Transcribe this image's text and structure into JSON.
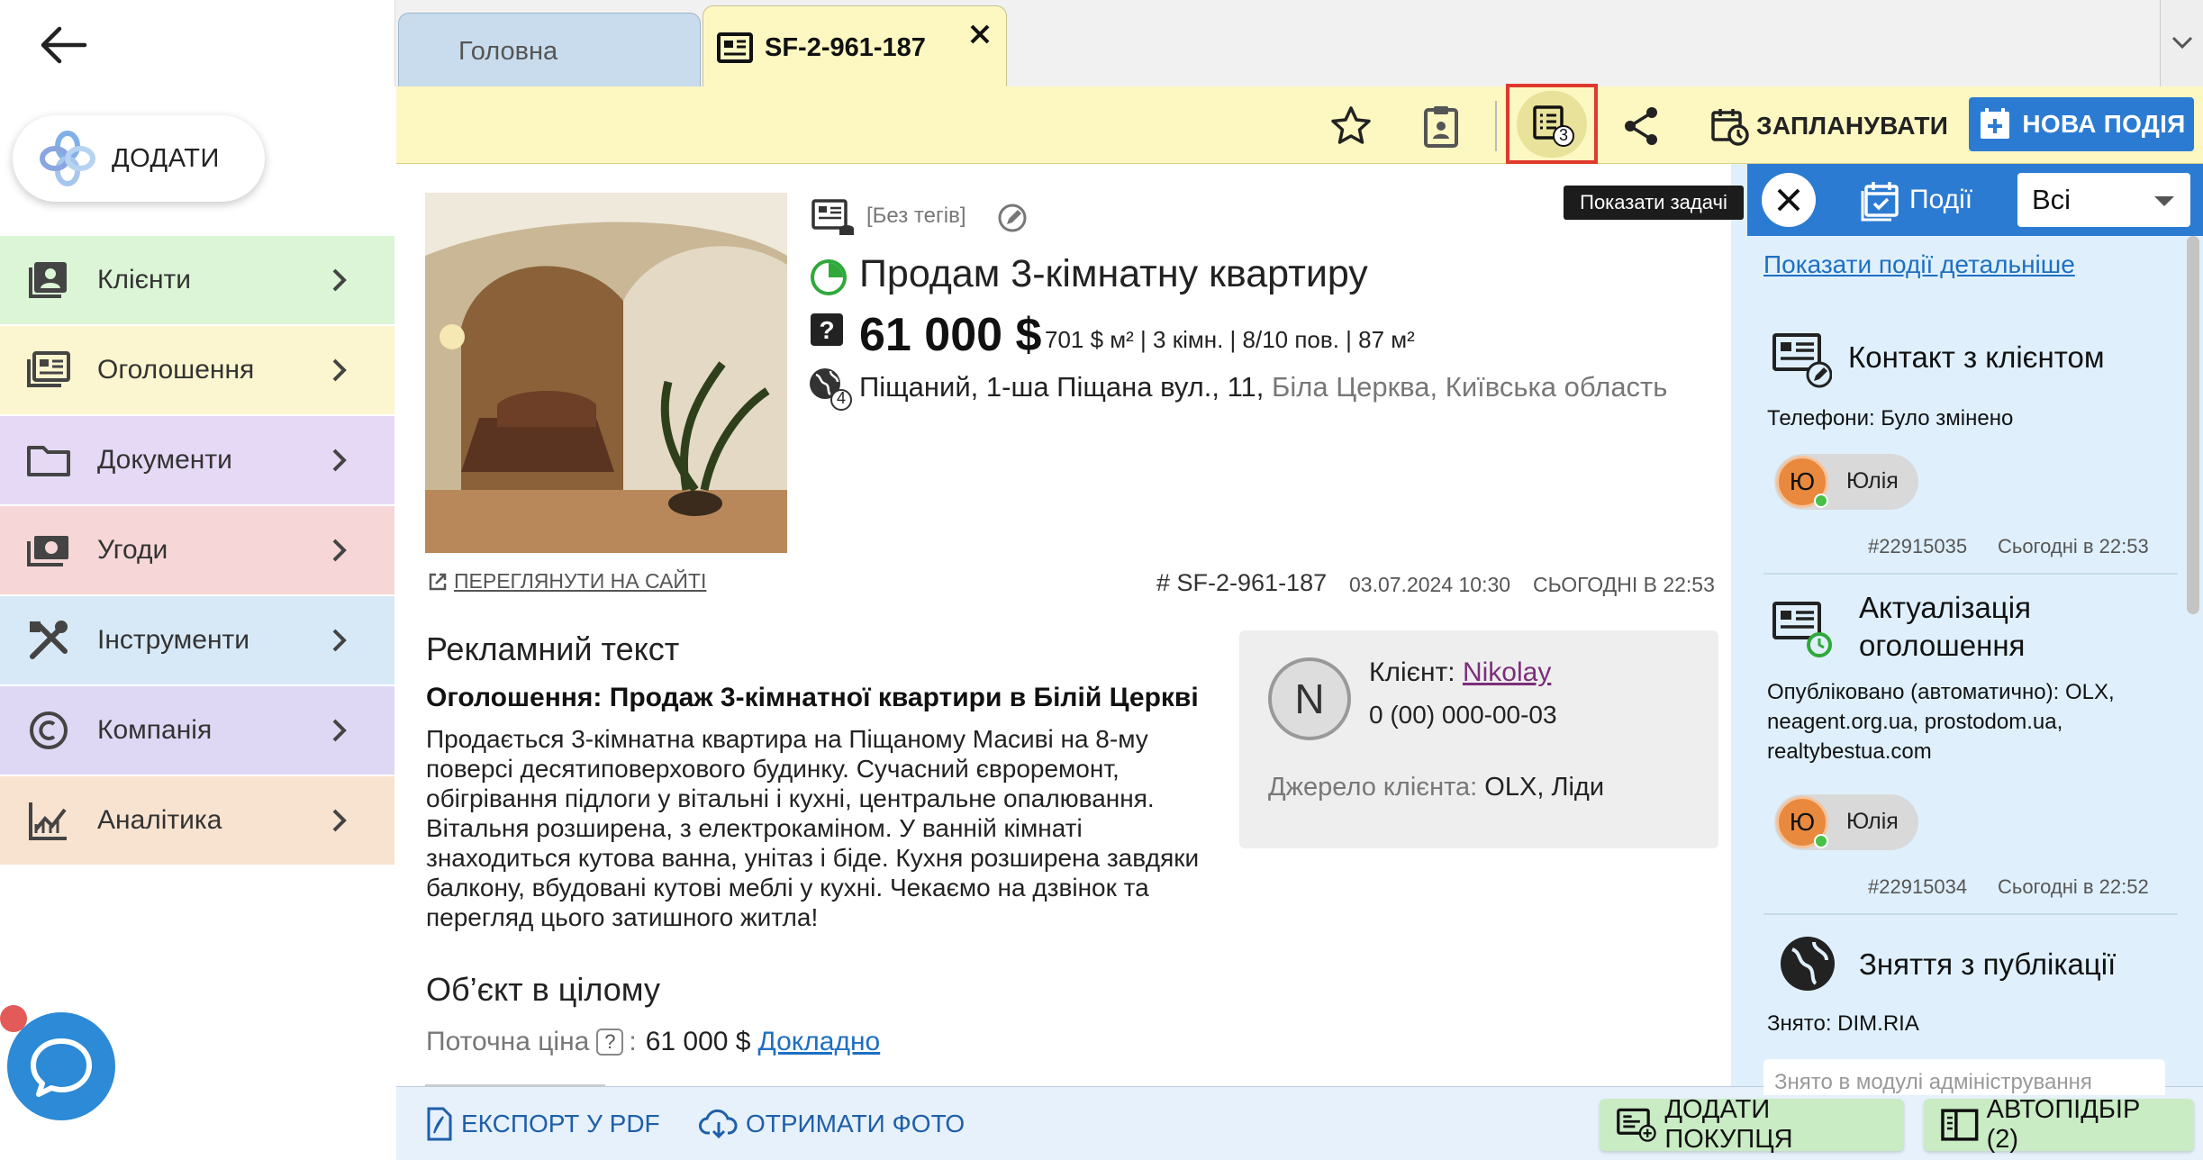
{
  "sidebar": {
    "add_label": "ДОДАТИ",
    "items": [
      {
        "label": "Клієнти",
        "bg": "#dbf5d6"
      },
      {
        "label": "Оголошення",
        "bg": "#fbf6cf"
      },
      {
        "label": "Документи",
        "bg": "#e6d9f6"
      },
      {
        "label": "Угоди",
        "bg": "#f6d6d6"
      },
      {
        "label": "Інструменти",
        "bg": "#d7e9f7"
      },
      {
        "label": "Компанія",
        "bg": "#dfd8f4"
      },
      {
        "label": "Аналітика",
        "bg": "#f8e3d1"
      }
    ]
  },
  "tabs": {
    "home": "Головна",
    "active": "SF-2-961-187"
  },
  "toolbar": {
    "tasks_badge": "3",
    "schedule_label": "ЗАПЛАНУВАТИ",
    "new_event_label": "НОВА ПОДІЯ",
    "tooltip": "Показати задачі"
  },
  "listing": {
    "tags": "[Без тегів]",
    "title": "Продам 3-кімнатну квартиру",
    "price": "61 000 $",
    "params": "701 $ м² | 3 кімн. | 8/10 пов. | 87 м²",
    "address_street": "Піщаний, 1-ша Піщана вул., 11,",
    "address_city": "Біла Церква, Київська область",
    "globe_badge": "4",
    "view_site": "ПЕРЕГЛЯНУТИ НА САЙТІ",
    "id": "# SF-2-961-187",
    "created": "03.07.2024 10:30",
    "updated": "СЬОГОДНІ В 22:53",
    "ad_heading": "Рекламний текст",
    "ad_title": "Оголошення: Продаж 3-кімнатної квартири в Білій Церкві",
    "ad_body": "Продається 3-кімнатна квартира на Піщаному Масиві на 8-му поверсі десятиповерхового будинку. Сучасний євроремонт, обігрівання підлоги у вітальні і кухні, центральне опалювання. Вітальня розширена, з електрокаміном. У ванній кімнаті знаходиться кутова ванна, унітаз і біде. Кухня розширена завдяки балкону, вбудовані кутові меблі у кухні. Чекаємо на дзвінок та перегляд цього затишного житла!",
    "object_heading": "Об’єкт в цілому",
    "current_price_label": "Поточна ціна",
    "current_price_q": "?",
    "current_price_colon": ":",
    "current_price_value": "61 000 $",
    "details_link": "Докладно"
  },
  "client": {
    "avatar_letter": "N",
    "label": "Клієнт:",
    "name": "Nikolay",
    "phone": "0 (00) 000-00-03",
    "source_label": "Джерело клієнта:",
    "source_value": "OLX, Ліди"
  },
  "bottom": {
    "export_pdf": "ЕКСПОРТ У PDF",
    "get_photo": "ОТРИМАТИ ФОТО",
    "add_purchase": "ДОДАТИ ПОКУПЦЯ",
    "autoselect": "АВТОПІДБІР (2)"
  },
  "events_panel": {
    "tab_label": "Події",
    "filter_value": "Всі",
    "details_link": "Показати події детальніше",
    "events": [
      {
        "title_line1": "Контакт з клієнтом",
        "title_line2": "",
        "text": "Телефони: Було змінено",
        "user_initial": "Ю",
        "user_name": "Юлія",
        "id": "#22915035",
        "time": "Сьогодні в 22:53",
        "icon": "contact-edit-icon"
      },
      {
        "title_line1": "Актуалізація",
        "title_line2": "оголошення",
        "text": "Опубліковано (автоматично): OLX, neagent.org.ua, prostodom.ua, realtybestua.com",
        "user_initial": "Ю",
        "user_name": "Юлія",
        "id": "#22915034",
        "time": "Сьогодні в 22:52",
        "icon": "listing-refresh-icon"
      },
      {
        "title_line1": "Зняття з публікації",
        "title_line2": "",
        "text": "Знято: DIM.RIA",
        "note_placeholder": "Знято в модулі адміністрування",
        "icon": "globe-remove-icon"
      }
    ]
  }
}
